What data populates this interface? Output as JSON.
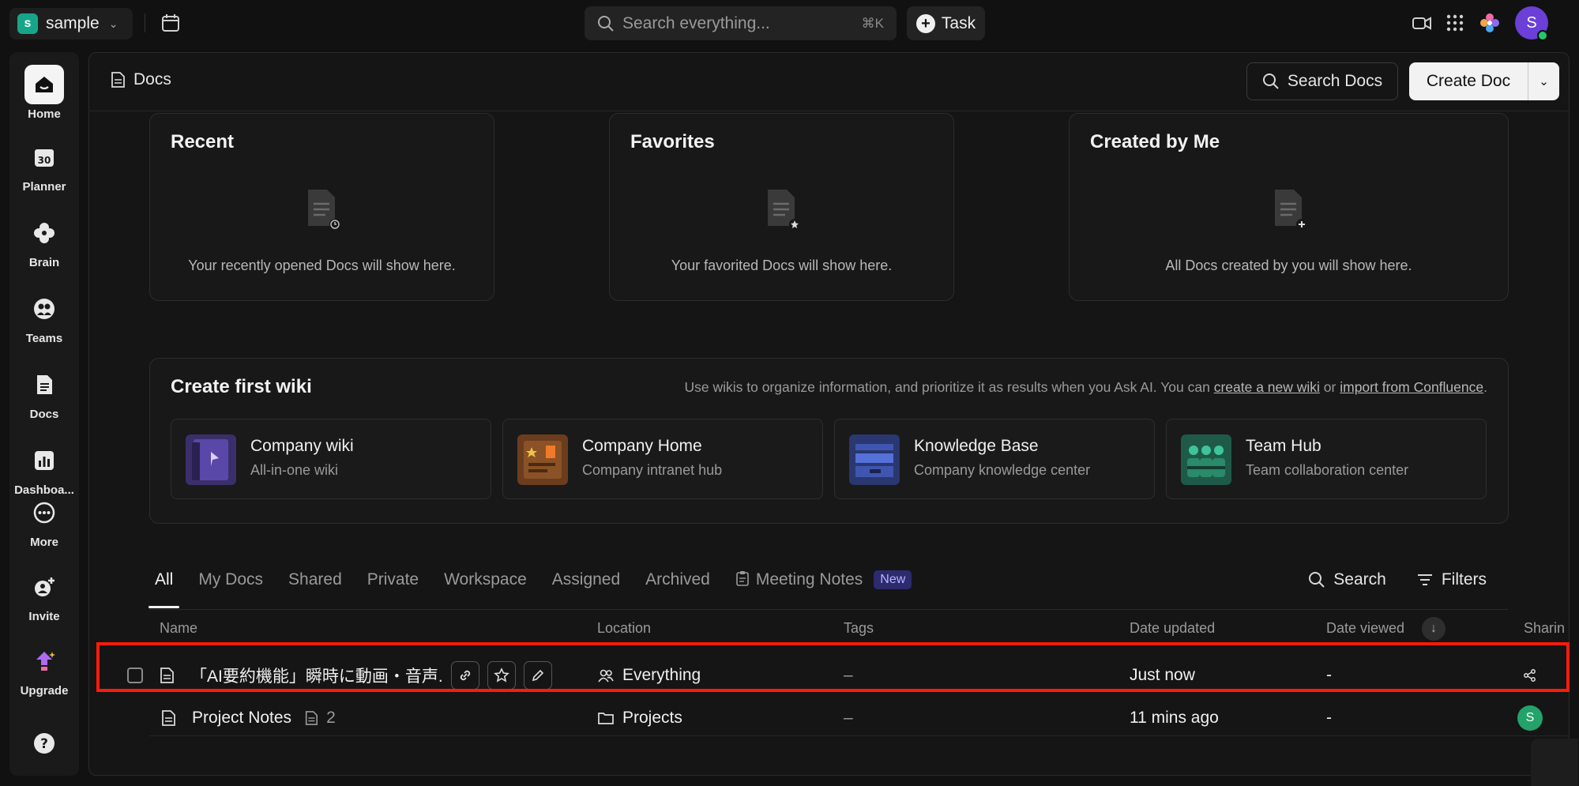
{
  "workspace": {
    "initial": "s",
    "name": "sample"
  },
  "search": {
    "placeholder": "Search everything...",
    "shortcut": "⌘K"
  },
  "task_button": {
    "label": "Task"
  },
  "user": {
    "initial": "S"
  },
  "rail": [
    {
      "label": "Home",
      "icon": "home-icon"
    },
    {
      "label": "Planner",
      "icon": "calendar-icon"
    },
    {
      "label": "Brain",
      "icon": "brain-icon"
    },
    {
      "label": "Teams",
      "icon": "teams-icon"
    },
    {
      "label": "Docs",
      "icon": "doc-icon"
    },
    {
      "label": "Dashboa...",
      "icon": "dashboard-icon"
    },
    {
      "label": "More",
      "icon": "more-icon"
    },
    {
      "label": "Invite",
      "icon": "invite-icon"
    },
    {
      "label": "Upgrade",
      "icon": "upgrade-icon"
    },
    {
      "label": "?",
      "icon": "help-icon"
    }
  ],
  "header": {
    "breadcrumb": "Docs",
    "search_docs": "Search Docs",
    "create_doc": "Create Doc"
  },
  "cards": [
    {
      "title": "Recent",
      "message": "Your recently opened Docs will show here."
    },
    {
      "title": "Favorites",
      "message": "Your favorited Docs will show here."
    },
    {
      "title": "Created by Me",
      "message": "All Docs created by you will show here."
    }
  ],
  "wiki": {
    "title": "Create first wiki",
    "desc_prefix": "Use wikis to organize information, and prioritize it as results when you Ask AI. You can ",
    "link_new": "create a new wiki",
    "desc_or": " or ",
    "link_import": "import from Confluence",
    "desc_suffix": ".",
    "templates": [
      {
        "name": "Company wiki",
        "sub": "All-in-one wiki",
        "color": "#3b2f6b"
      },
      {
        "name": "Company Home",
        "sub": "Company intranet hub",
        "color": "#6b3d1e"
      },
      {
        "name": "Knowledge Base",
        "sub": "Company knowledge center",
        "color": "#2a3770"
      },
      {
        "name": "Team Hub",
        "sub": "Team collaboration center",
        "color": "#1f5a48"
      }
    ]
  },
  "tabs": [
    "All",
    "My Docs",
    "Shared",
    "Private",
    "Workspace",
    "Assigned",
    "Archived",
    "Meeting Notes"
  ],
  "tab_badge": "New",
  "tab_actions": {
    "search": "Search",
    "filters": "Filters"
  },
  "columns": {
    "name": "Name",
    "location": "Location",
    "tags": "Tags",
    "date_updated": "Date updated",
    "date_viewed": "Date viewed",
    "sharing": "Sharin"
  },
  "rows": [
    {
      "name": "「AI要約機能」瞬時に動画・音声...",
      "location": "Everything",
      "tags": "–",
      "date_updated": "Just now",
      "date_viewed": "-"
    },
    {
      "name": "Project Notes",
      "subcount": "2",
      "location": "Projects",
      "tags": "–",
      "date_updated": "11 mins ago",
      "date_viewed": "-",
      "sharing_initial": "S"
    }
  ],
  "colors": {
    "accent_highlight": "#ff1a0a",
    "avatar_purple": "#6b3fd8",
    "avatar_green": "#23a36a",
    "workspace_logo": "#17a589"
  }
}
